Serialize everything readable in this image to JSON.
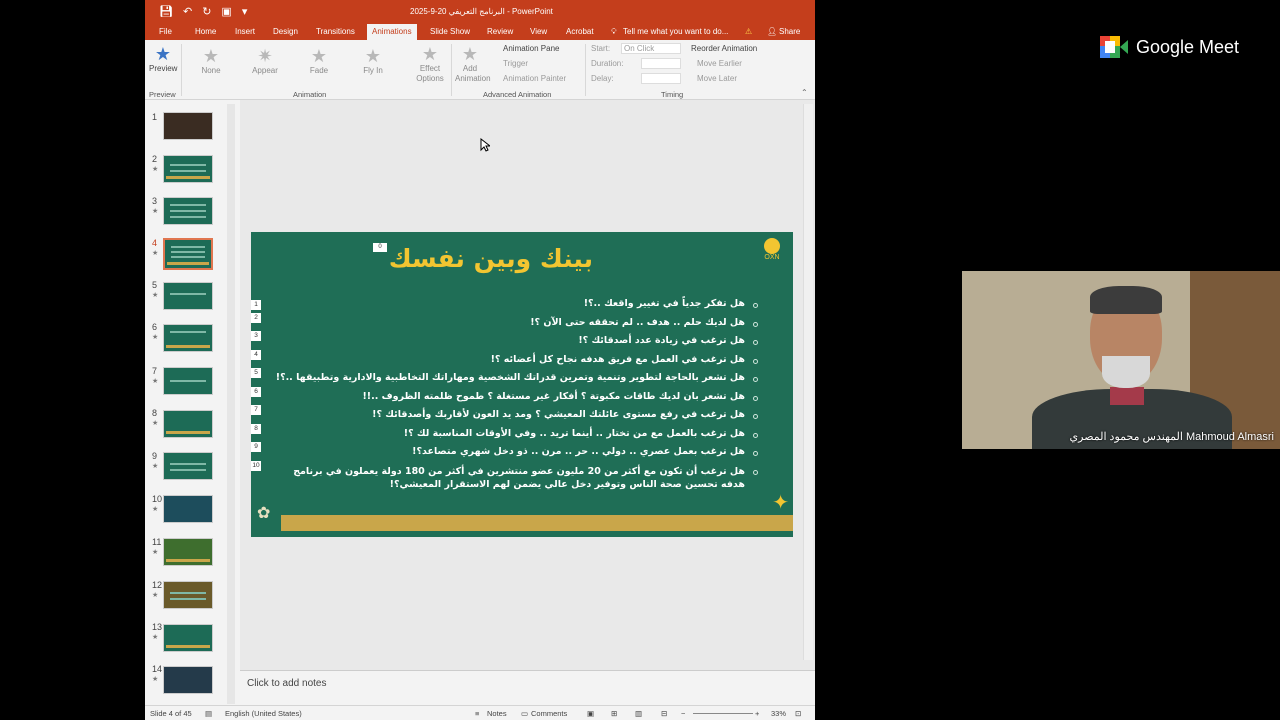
{
  "powerpoint": {
    "window_title": "البرنامج التعريفي 20-9-2025 - PowerPoint",
    "tabs": [
      "File",
      "Home",
      "Insert",
      "Design",
      "Transitions",
      "Animations",
      "Slide Show",
      "Review",
      "View",
      "Acrobat"
    ],
    "active_tab": "Animations",
    "tell_me": "Tell me what you want to do...",
    "share": "Share",
    "ribbon": {
      "preview_label": "Preview",
      "preview_group": "Preview",
      "animation_group": "Animation",
      "animations": [
        "None",
        "Appear",
        "Fade",
        "Fly In"
      ],
      "effect_options": "Effect Options",
      "add_animation": "Add Animation",
      "animation_pane": "Animation Pane",
      "trigger": "Trigger",
      "animation_painter": "Animation Painter",
      "advanced_group": "Advanced Animation",
      "start_label": "Start:",
      "start_value": "On Click",
      "duration_label": "Duration:",
      "delay_label": "Delay:",
      "reorder": "Reorder Animation",
      "move_earlier": "Move Earlier",
      "move_later": "Move Later",
      "timing_group": "Timing"
    },
    "thumbnails": [
      "1",
      "2",
      "3",
      "4",
      "5",
      "6",
      "7",
      "8",
      "9",
      "10",
      "11",
      "12",
      "13",
      "14"
    ],
    "selected_slide": 4,
    "slide": {
      "title": "بينك وبين نفسك",
      "logo_text": "OXN",
      "questions": [
        "هل تفكر جدياً في تغيير واقعك ..؟!",
        "هل لديك حلم .. هدف .. لم تحققه حتى الآن ؟!",
        "هل ترغب في زيادة عدد أصدقائك ؟!",
        "هل ترغب في العمل مع فريق هدفه نجاح كل أعضائه ؟!",
        "هل تشعر بالحاجة لتطوير وتنمية وتمرين قدراتك الشخصية ومهاراتك التخاطبية والادارية وتطبيقها ..؟!",
        "هل تشعر بان لديك طاقات مكبوتة ؟ أفكار غير مستغلة ؟ طموح ظلمته الظروف ..!!",
        "هل ترغب في رفع مستوى عائلتك المعيشي ؟ ومد يد العون لأقاربك وأصدقائك ؟!",
        "هل ترغب بالعمل مع من تختار .. أينما تريد .. وفي الأوقات المناسبة لك ؟!",
        "هل ترغب بعمل عصري .. دولي .. حر .. مرن .. ذو دخل شهري متصاعد؟!",
        "هل ترغب أن تكون مع أكثر من 20 مليون عضو منتشرين في أكثر من 180 دولة يعملون في برنامج هدفه تحسين صحة الناس وتوفير دخل عالي يضمن لهم الاستقرار المعيشي؟!"
      ],
      "animation_numbers": [
        "0",
        "1",
        "2",
        "3",
        "4",
        "5",
        "6",
        "7",
        "8",
        "9",
        "10"
      ]
    },
    "notes_placeholder": "Click to add notes",
    "status": {
      "slide_info": "Slide 4 of 45",
      "language": "English (United States)",
      "notes": "Notes",
      "comments": "Comments",
      "zoom": "33%"
    }
  },
  "meet": {
    "brand": "Google Meet",
    "participant_name": "المهندس محمود المصري Mahmoud Almasri"
  },
  "colors": {
    "ppt_accent": "#c43e1c",
    "slide_bg": "#1f6e56",
    "slide_title": "#f2c531",
    "slide_footer_bar": "#c9a64a"
  }
}
